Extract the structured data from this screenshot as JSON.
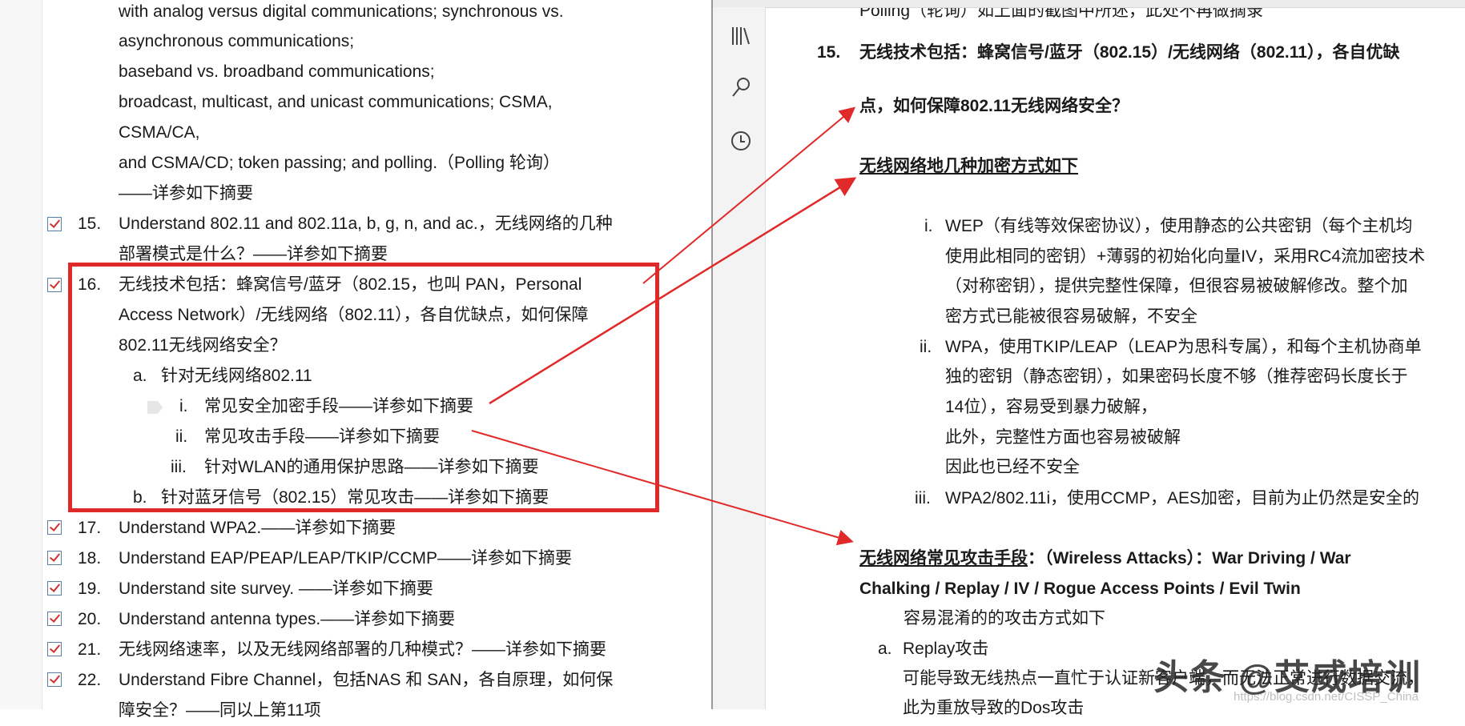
{
  "left": {
    "intro_lines": [
      "with analog versus digital communications; synchronous vs.",
      "asynchronous communications;",
      "baseband vs. broadband communications;",
      "broadcast, multicast, and unicast communications; CSMA,",
      "CSMA/CA,",
      "and CSMA/CD; token passing; and polling.（Polling  轮询）",
      "——详参如下摘要"
    ],
    "items": [
      {
        "num": "15.",
        "lines": [
          "Understand 802.11 and 802.11a, b, g, n, and ac.，无线网络的几种",
          "部署模式是什么？——详参如下摘要"
        ]
      },
      {
        "num": "16.",
        "lines": [
          "无线技术包括：蜂窝信号/蓝牙（802.15，也叫 PAN，Personal",
          "Access Network）/无线网络（802.11），各自优缺点，如何保障",
          "802.11无线网络安全？"
        ]
      },
      {
        "num": "17.",
        "lines": [
          "Understand WPA2.——详参如下摘要"
        ]
      },
      {
        "num": "18.",
        "lines": [
          "Understand EAP/PEAP/LEAP/TKIP/CCMP——详参如下摘要"
        ]
      },
      {
        "num": "19.",
        "lines": [
          "Understand site survey. ——详参如下摘要"
        ]
      },
      {
        "num": "20.",
        "lines": [
          "Understand antenna types.——详参如下摘要"
        ]
      },
      {
        "num": "21.",
        "lines": [
          "无线网络速率，以及无线网络部署的几种模式？——详参如下摘要"
        ]
      },
      {
        "num": "22.",
        "lines": [
          "Understand Fibre Channel，包括NAS 和 SAN，各自原理，如何保",
          "障安全？——同以上第11项"
        ]
      }
    ],
    "sub_a": {
      "marker": "a.",
      "text": "针对无线网络802.11"
    },
    "sub_i": {
      "marker": "i.",
      "text": "常见安全加密手段——详参如下摘要"
    },
    "sub_ii": {
      "marker": "ii.",
      "text": "常见攻击手段——详参如下摘要"
    },
    "sub_iii": {
      "marker": "iii.",
      "text": "针对WLAN的通用保护思路——详参如下摘要"
    },
    "sub_b": {
      "marker": "b.",
      "text": "针对蓝牙信号（802.15）常见攻击——详参如下摘要"
    }
  },
  "right": {
    "polling_line": "Polling（轮询）如上面的截图中所述，此处不再做摘录",
    "heading15_num": "15.",
    "heading15_lines": [
      "无线技术包括：蜂窝信号/蓝牙（802.15）/无线网络（802.11），各自优缺",
      "点，如何保障802.11无线网络安全？"
    ],
    "enc_heading": "无线网络地几种加密方式如下",
    "enc_items": [
      {
        "marker": "i.",
        "lines": [
          "WEP（有线等效保密协议），使用静态的公共密钥（每个主机均",
          "使用此相同的密钥）+薄弱的初始化向量IV，采用RC4流加密技术",
          "（对称密钥），提供完整性保障，但很容易被破解修改。整个加",
          "密方式已能被很容易破解，不安全"
        ]
      },
      {
        "marker": "ii.",
        "lines": [
          "WPA，使用TKIP/LEAP（LEAP为思科专属），和每个主机协商单",
          "独的密钥（静态密钥），如果密码长度不够（推荐密码长度长于",
          "14位），容易受到暴力破解，",
          "此外，完整性方面也容易被破解",
          "因此也已经不安全"
        ]
      },
      {
        "marker": "iii.",
        "lines": [
          "WPA2/802.11i，使用CCMP，AES加密，目前为止仍然是安全的"
        ]
      }
    ],
    "attack_heading_underlined": "无线网络常见攻击手段",
    "attack_heading_rest": "：（Wireless Attacks）：War Driving / War",
    "attack_heading_line2": "Chalking / Replay /  IV / Rogue Access Points / Evil Twin",
    "confusing_line": "容易混淆的的攻击方式如下",
    "replay_marker": "a.",
    "replay_title": "Replay攻击",
    "replay_lines": [
      "可能导致无线热点一直忙于认证新客户端，而无法正常进行数据交流，",
      "此为重放导致的Dos攻击"
    ]
  },
  "watermark": {
    "text": "头条 @艾威培训",
    "url": "https://blog.csdn.net/CISSP_China"
  },
  "colors": {
    "annotation_red": "#e02a2a",
    "checkbox_border": "#5b7fa6"
  }
}
